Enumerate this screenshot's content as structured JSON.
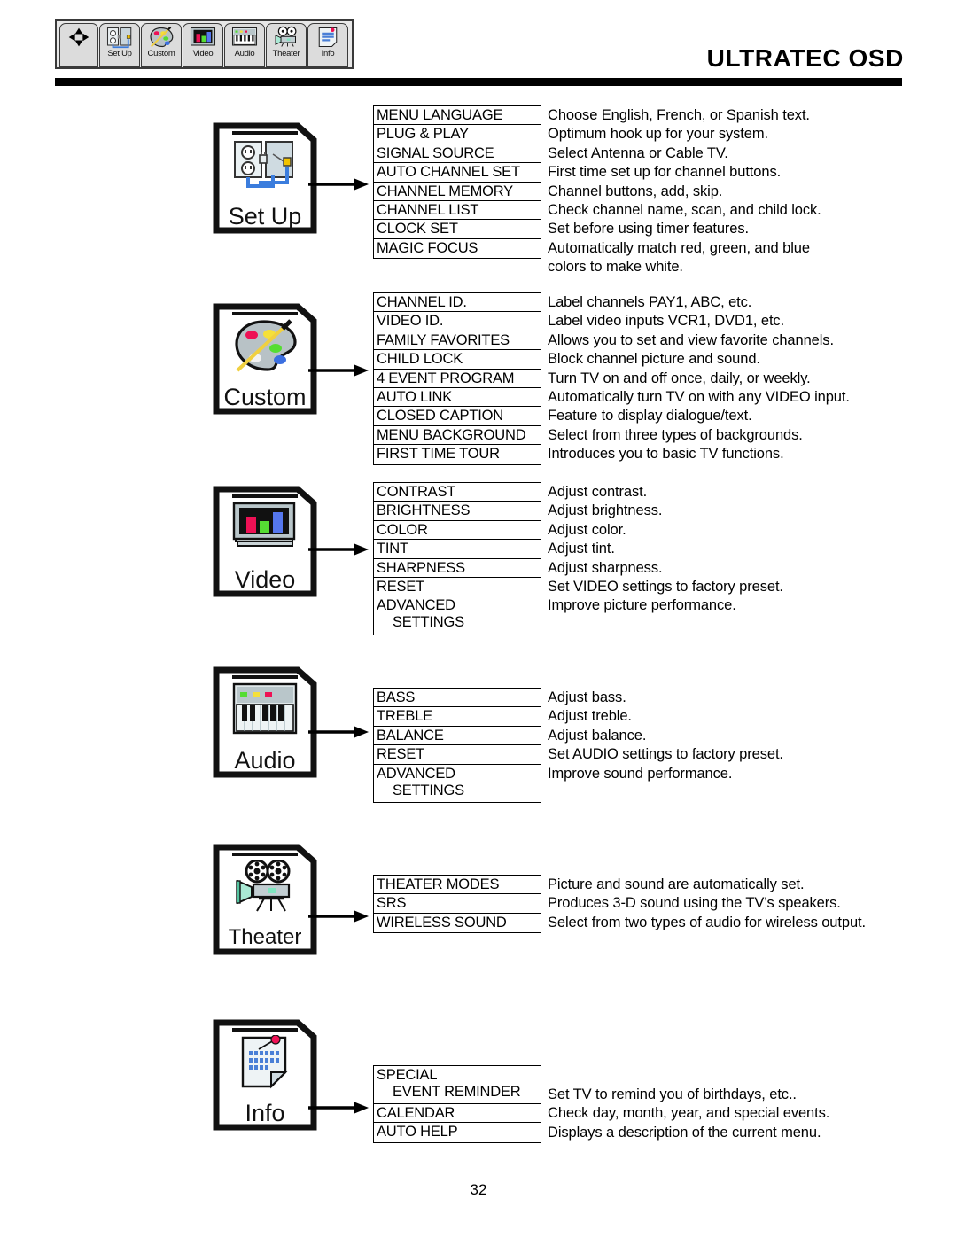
{
  "header": {
    "title": "ULTRATEC OSD",
    "toolbar": {
      "nav_icon": "dpad-icon",
      "tabs": [
        {
          "label": "Set Up",
          "icon": "outlet-plug-icon"
        },
        {
          "label": "Custom",
          "icon": "paint-palette-icon"
        },
        {
          "label": "Video",
          "icon": "tv-color-bars-icon"
        },
        {
          "label": "Audio",
          "icon": "keyboard-piano-icon"
        },
        {
          "label": "Theater",
          "icon": "movie-projector-icon"
        },
        {
          "label": "Info",
          "icon": "note-pinned-icon"
        }
      ]
    }
  },
  "sections": [
    {
      "name": "Set Up",
      "icon": "outlet-plug-icon",
      "items": [
        {
          "label": "MENU LANGUAGE",
          "desc": "Choose English, French, or Spanish text."
        },
        {
          "label": "PLUG & PLAY",
          "desc": "Optimum hook up for your system."
        },
        {
          "label": "SIGNAL SOURCE",
          "desc": "Select Antenna or Cable TV."
        },
        {
          "label": "AUTO CHANNEL SET",
          "desc": "First time set up for channel buttons."
        },
        {
          "label": "CHANNEL MEMORY",
          "desc": "Channel buttons, add, skip."
        },
        {
          "label": "CHANNEL LIST",
          "desc": "Check channel name, scan, and child lock."
        },
        {
          "label": "CLOCK SET",
          "desc": "Set before using timer features."
        },
        {
          "label": "MAGIC FOCUS",
          "desc": "Automatically match red, green, and blue"
        }
      ],
      "extra_desc": "colors to make white."
    },
    {
      "name": "Custom",
      "icon": "paint-palette-icon",
      "items": [
        {
          "label": "CHANNEL ID.",
          "desc": "Label channels PAY1, ABC, etc."
        },
        {
          "label": "VIDEO ID.",
          "desc": "Label video inputs VCR1, DVD1, etc."
        },
        {
          "label": "FAMILY FAVORITES",
          "desc": "Allows you to set and view favorite channels."
        },
        {
          "label": "CHILD LOCK",
          "desc": "Block channel picture and sound."
        },
        {
          "label": "4 EVENT PROGRAM",
          "desc": "Turn TV on and off once, daily, or weekly."
        },
        {
          "label": "AUTO LINK",
          "desc": "Automatically turn TV on with any VIDEO input."
        },
        {
          "label": "CLOSED CAPTION",
          "desc": "Feature to display dialogue/text."
        },
        {
          "label": "MENU BACKGROUND",
          "desc": "Select from three types of backgrounds."
        },
        {
          "label": "FIRST TIME TOUR",
          "desc": "Introduces you to basic TV functions."
        }
      ]
    },
    {
      "name": "Video",
      "icon": "tv-color-bars-icon",
      "items": [
        {
          "label": "CONTRAST",
          "desc": "Adjust contrast."
        },
        {
          "label": "BRIGHTNESS",
          "desc": "Adjust brightness."
        },
        {
          "label": "COLOR",
          "desc": "Adjust color."
        },
        {
          "label": "TINT",
          "desc": "Adjust tint."
        },
        {
          "label": "SHARPNESS",
          "desc": "Adjust sharpness."
        },
        {
          "label": "RESET",
          "desc": "Set VIDEO settings to factory preset."
        },
        {
          "label": "ADVANCED",
          "label2": "SETTINGS",
          "desc": "Improve picture performance."
        }
      ]
    },
    {
      "name": "Audio",
      "icon": "keyboard-piano-icon",
      "items": [
        {
          "label": "BASS",
          "desc": "Adjust bass."
        },
        {
          "label": "TREBLE",
          "desc": "Adjust treble."
        },
        {
          "label": "BALANCE",
          "desc": "Adjust balance."
        },
        {
          "label": "RESET",
          "desc": "Set AUDIO settings to factory preset."
        },
        {
          "label": "ADVANCED",
          "label2": "SETTINGS",
          "desc": "Improve sound performance."
        }
      ]
    },
    {
      "name": "Theater",
      "icon": "movie-projector-icon",
      "items": [
        {
          "label": "THEATER MODES",
          "desc": "Picture and sound are automatically set."
        },
        {
          "label": "SRS",
          "desc": "Produces 3-D sound using the TV’s speakers."
        },
        {
          "label": "WIRELESS SOUND",
          "desc": "Select from two types of audio for wireless output."
        }
      ]
    },
    {
      "name": "Info",
      "icon": "note-pinned-icon",
      "items": [
        {
          "label": "SPECIAL",
          "label2": "EVENT REMINDER",
          "desc": "Set TV to remind you of birthdays, etc.."
        },
        {
          "label": "CALENDAR",
          "desc": "Check day, month, year, and special events."
        },
        {
          "label": "AUTO HELP",
          "desc": "Displays a description of the current menu."
        }
      ]
    }
  ],
  "page_number": "32",
  "colors": {
    "red": "#ee1155",
    "green": "#55dd33",
    "blue": "#5577ee",
    "yellow": "#f5e03a",
    "rule": "#000000",
    "toolbar_bg": "#e8e8e8"
  }
}
